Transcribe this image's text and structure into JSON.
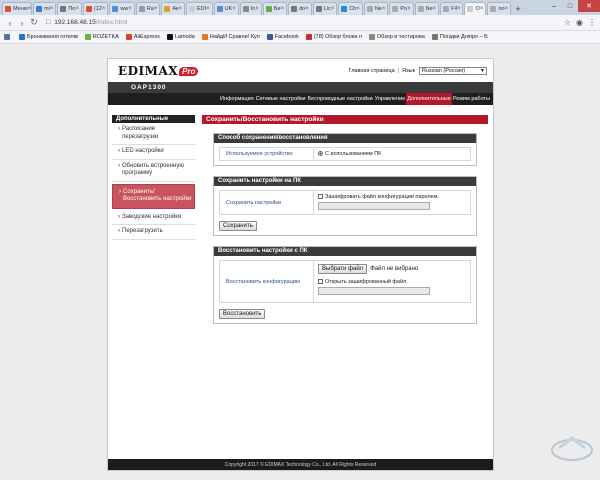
{
  "browser": {
    "tabs": [
      {
        "label": "Меню",
        "color": "#e04b3a",
        "active": false
      },
      {
        "label": "mi",
        "color": "#3a7bd5",
        "active": false
      },
      {
        "label": "По",
        "color": "#777777",
        "active": false
      },
      {
        "label": "(12",
        "color": "#e04b3a",
        "active": false
      },
      {
        "label": "ww",
        "color": "#4a90d9",
        "active": false
      },
      {
        "label": "Ra",
        "color": "#999999",
        "active": false
      },
      {
        "label": "Ак",
        "color": "#e0a030",
        "active": false
      },
      {
        "label": "EDI",
        "color": "#cccccc",
        "active": false
      },
      {
        "label": "UK",
        "color": "#5a8ad0",
        "active": false
      },
      {
        "label": "In",
        "color": "#888888",
        "active": false
      },
      {
        "label": "Бе",
        "color": "#6aa84f",
        "active": false
      },
      {
        "label": "do",
        "color": "#777777",
        "active": false
      },
      {
        "label": "Lic",
        "color": "#777777",
        "active": false
      },
      {
        "label": "Ch",
        "color": "#2a88d8",
        "active": false
      },
      {
        "label": "Ne",
        "color": "#aaaaaa",
        "active": false
      },
      {
        "label": "Po",
        "color": "#aaaaaa",
        "active": false
      },
      {
        "label": "Ne",
        "color": "#aaaaaa",
        "active": false
      },
      {
        "label": "Fil",
        "color": "#aaaaaa",
        "active": false
      },
      {
        "label": "O",
        "color": "#cccccc",
        "active": true
      },
      {
        "label": "no",
        "color": "#aaaaaa",
        "active": false
      }
    ],
    "url_host": "192.168.48.15",
    "url_path": "/index.html",
    "bookmarks": [
      {
        "label": "Бронювання готелів",
        "color": "#2a6fc9"
      },
      {
        "label": "ROZETKA",
        "color": "#6bb23a"
      },
      {
        "label": "AliExpress",
        "color": "#e2402d"
      },
      {
        "label": "Lamoda",
        "color": "#111111"
      },
      {
        "label": "НайдИ Сравни! Куп",
        "color": "#e07a1f"
      },
      {
        "label": "Facebook",
        "color": "#3b5998"
      },
      {
        "label": "(78) Обзор блока п",
        "color": "#cc2b2b"
      },
      {
        "label": "Обзор и тестирова",
        "color": "#888888"
      },
      {
        "label": "Поїздки Дніпро – Б",
        "color": "#777777"
      }
    ]
  },
  "router": {
    "logo_text": "EDIMAX",
    "logo_badge": "Pro",
    "home_link": "Главная страница",
    "lang_link": "Язык",
    "language": "Russian (Россия)",
    "model": "OAP1300",
    "menu": [
      "Информация",
      "Сетевые настройки",
      "Беспроводные настройки",
      "Управление",
      "Дополнительные",
      "Режим работы"
    ],
    "menu_active": 4,
    "sidebar_title": "Дополнительные",
    "sidebar_items": [
      {
        "label": "Расписание перезагрузки",
        "active": false
      },
      {
        "label": "LED настройки",
        "active": false
      },
      {
        "label": "Обновить встроенную программу",
        "active": false
      },
      {
        "label": "Сохранить/ Восстановить настройки",
        "active": true
      },
      {
        "label": "Заводские настройки",
        "active": false
      },
      {
        "label": "Перезагрузить",
        "active": false
      }
    ],
    "content_title": "Сохранить/Восстановить настройки",
    "method_section": {
      "title": "Способ сохранения/восстановления",
      "label": "Используемое устройство",
      "option": "С использованием ПК"
    },
    "save_section": {
      "title": "Сохранить настройки на ПК",
      "label": "Сохранить настройки",
      "checkbox": "Зашифровать файл конфигурации паролем.",
      "button": "Сохранить"
    },
    "restore_section": {
      "title": "Восстановить настройки с ПК",
      "label": "Восстановить конфигурацию",
      "file_button": "Выбрати файл",
      "no_file": "Файл не вибрано",
      "checkbox": "Открыть зашифрованный файл.",
      "button": "Восстановить"
    },
    "footer": "Copyright 2017 © EDIMAX Technology Co., Ltd. All Rights Reserved"
  }
}
